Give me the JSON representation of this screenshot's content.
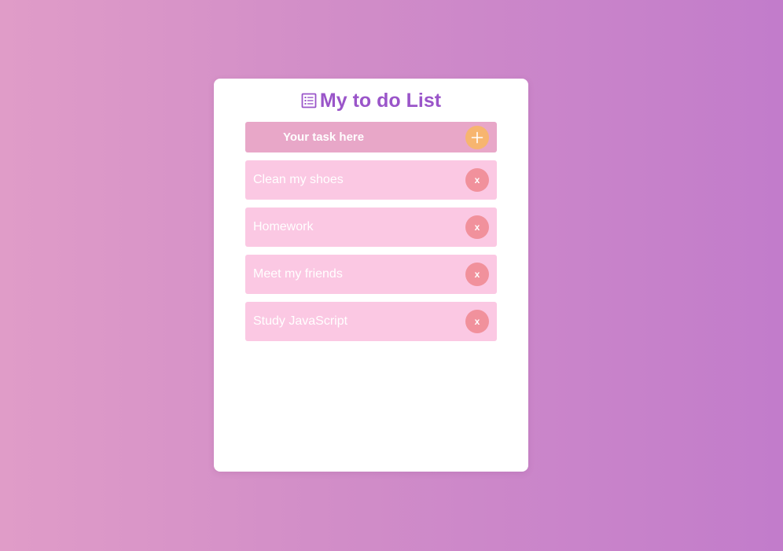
{
  "app": {
    "title": "My to do List",
    "title_icon": "list-icon",
    "title_color": "#9a55c9"
  },
  "input": {
    "placeholder": "Your task here",
    "value": "",
    "add_icon": "plus-icon",
    "add_button_color": "#f7b56f",
    "background_color": "#e8a7c8"
  },
  "tasks": [
    {
      "text": "Clean my shoes",
      "delete_label": "x"
    },
    {
      "text": "Homework",
      "delete_label": "x"
    },
    {
      "text": "Meet my friends",
      "delete_label": "x"
    },
    {
      "text": "Study JavaScript",
      "delete_label": "x"
    }
  ],
  "colors": {
    "task_background": "#fbc8e3",
    "delete_button": "#f1919c",
    "gradient_start": "#e09cc8",
    "gradient_end": "#c27ccb"
  }
}
